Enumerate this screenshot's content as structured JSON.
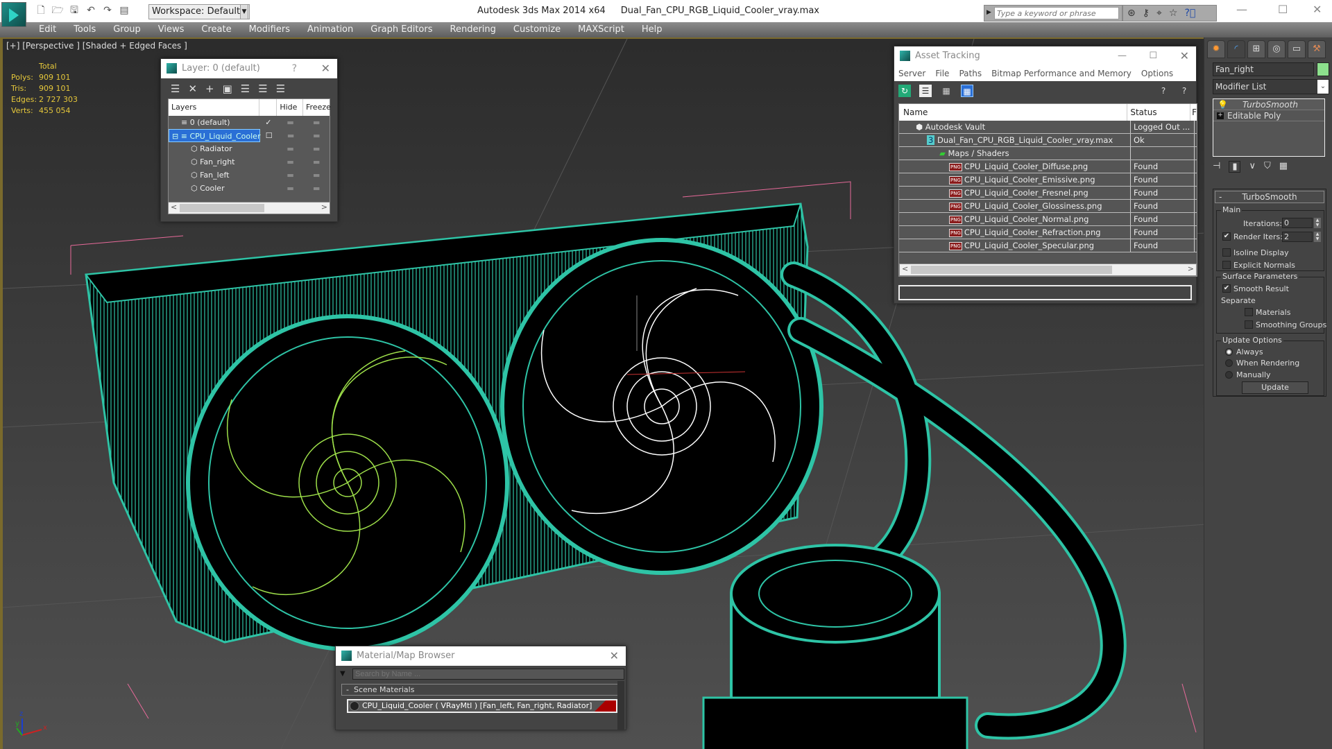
{
  "titlebar": {
    "app_title": "Autodesk 3ds Max  2014 x64",
    "file_name": "Dual_Fan_CPU_RGB_Liquid_Cooler_vray.max",
    "workspace_label": "Workspace: Default",
    "search_placeholder": "Type a keyword or phrase",
    "search_tools": [
      "binoculars-icon",
      "key-icon",
      "satellite-icon",
      "star-icon",
      "help-icon"
    ],
    "minimize": "—",
    "maximize": "☐",
    "close": "✕"
  },
  "menubar": [
    "Edit",
    "Tools",
    "Group",
    "Views",
    "Create",
    "Modifiers",
    "Animation",
    "Graph Editors",
    "Rendering",
    "Customize",
    "MAXScript",
    "Help"
  ],
  "viewport": {
    "label": "[+] [Perspective ] [Shaded + Edged Faces ]",
    "stats": {
      "header": "Total",
      "rows": [
        {
          "k": "Polys:",
          "v": "909 101"
        },
        {
          "k": "Tris:",
          "v": "909 101"
        },
        {
          "k": "Edges:",
          "v": "2 727 303"
        },
        {
          "k": "Verts:",
          "v": "455 054"
        }
      ]
    },
    "wire_color": "#2ec4a6",
    "selected_wire_color": "#ffffff",
    "left_fan_wire_color": "#9ee04a",
    "axis": {
      "x": "x",
      "y": "y",
      "z": "z"
    }
  },
  "layer_dialog": {
    "title": "Layer: 0 (default)",
    "help": "?",
    "close": "✕",
    "columns": [
      "Layers",
      "",
      "Hide",
      "Freeze"
    ],
    "rows": [
      {
        "name": "0 (default)",
        "current": "✓",
        "indent": 1,
        "selected": false
      },
      {
        "name": "CPU_Liquid_Cooler",
        "current": "☐",
        "indent": 1,
        "selected": true
      },
      {
        "name": "Radiator",
        "current": "",
        "indent": 2,
        "selected": false
      },
      {
        "name": "Fan_right",
        "current": "",
        "indent": 2,
        "selected": false
      },
      {
        "name": "Fan_left",
        "current": "",
        "indent": 2,
        "selected": false
      },
      {
        "name": "Cooler",
        "current": "",
        "indent": 2,
        "selected": false
      }
    ],
    "hide_mark": "▬",
    "freeze_mark": "▬"
  },
  "asset_tracking": {
    "title": "Asset Tracking",
    "menu": [
      "Server",
      "File",
      "Paths",
      "Bitmap Performance and Memory",
      "Options"
    ],
    "columns": [
      "Name",
      "Status",
      "F"
    ],
    "rows": [
      {
        "name": "Autodesk Vault",
        "status": "Logged Out ...",
        "indent": 1,
        "icon": "vault-icon"
      },
      {
        "name": "Dual_Fan_CPU_RGB_Liquid_Cooler_vray.max",
        "status": "Ok",
        "indent": 2,
        "icon": "max-file-icon"
      },
      {
        "name": "Maps / Shaders",
        "status": "",
        "indent": 3,
        "icon": "maps-icon"
      },
      {
        "name": "CPU_Liquid_Cooler_Diffuse.png",
        "status": "Found",
        "indent": 4,
        "icon": "png-icon"
      },
      {
        "name": "CPU_Liquid_Cooler_Emissive.png",
        "status": "Found",
        "indent": 4,
        "icon": "png-icon"
      },
      {
        "name": "CPU_Liquid_Cooler_Fresnel.png",
        "status": "Found",
        "indent": 4,
        "icon": "png-icon"
      },
      {
        "name": "CPU_Liquid_Cooler_Glossiness.png",
        "status": "Found",
        "indent": 4,
        "icon": "png-icon"
      },
      {
        "name": "CPU_Liquid_Cooler_Normal.png",
        "status": "Found",
        "indent": 4,
        "icon": "png-icon"
      },
      {
        "name": "CPU_Liquid_Cooler_Refraction.png",
        "status": "Found",
        "indent": 4,
        "icon": "png-icon"
      },
      {
        "name": "CPU_Liquid_Cooler_Specular.png",
        "status": "Found",
        "indent": 4,
        "icon": "png-icon"
      }
    ],
    "png_label": "PNG"
  },
  "command_panel": {
    "object_name": "Fan_right",
    "object_color": "#8de08d",
    "modifier_list": "Modifier List",
    "stack": [
      {
        "name": "TurboSmooth",
        "italic": true
      },
      {
        "name": "Editable Poly",
        "italic": false
      }
    ],
    "turbosmooth": {
      "title": "TurboSmooth",
      "collapse": "-",
      "main_label": "Main",
      "iterations_label": "Iterations:",
      "iterations": "0",
      "render_iters_label": "Render Iters:",
      "render_iters": "2",
      "render_iters_checked": true,
      "isoline_display": "Isoline Display",
      "explicit_normals": "Explicit Normals",
      "surface_params": "Surface Parameters",
      "smooth_result": "Smooth Result",
      "separate": "Separate",
      "materials": "Materials",
      "smoothing_groups": "Smoothing Groups",
      "update_options": "Update Options",
      "always": "Always",
      "when_rendering": "When Rendering",
      "manually": "Manually",
      "update_button": "Update"
    }
  },
  "material_browser": {
    "title": "Material/Map Browser",
    "search_placeholder": "Search by Name ...",
    "section": "Scene Materials",
    "section_toggle": "-",
    "item": "CPU_Liquid_Cooler  ( VRayMtl ) [Fan_left, Fan_right, Radiator]"
  }
}
